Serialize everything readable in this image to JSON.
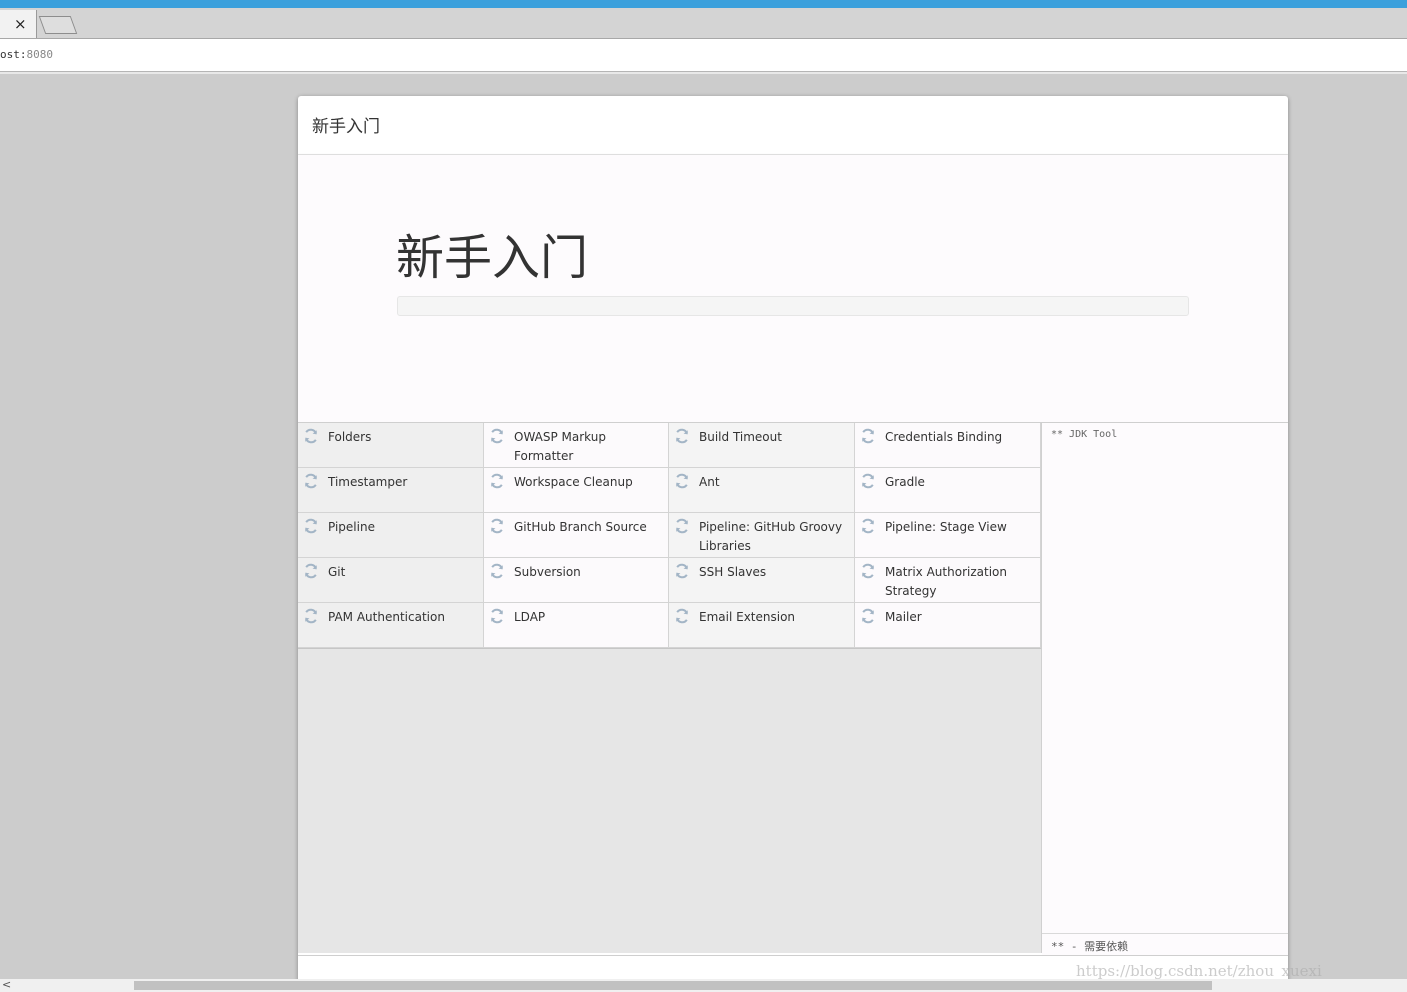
{
  "browser": {
    "tab_close": "×",
    "url_prefix": "ost:",
    "url_port": "8080"
  },
  "dialog": {
    "title": "新手入门",
    "hero_title": "新手入门",
    "progress": 0
  },
  "plugins": [
    {
      "name": "Folders"
    },
    {
      "name": "OWASP Markup Formatter"
    },
    {
      "name": "Build Timeout"
    },
    {
      "name": "Credentials Binding"
    },
    {
      "name": "Timestamper"
    },
    {
      "name": "Workspace Cleanup"
    },
    {
      "name": "Ant"
    },
    {
      "name": "Gradle"
    },
    {
      "name": "Pipeline"
    },
    {
      "name": "GitHub Branch Source"
    },
    {
      "name": "Pipeline: GitHub Groovy Libraries"
    },
    {
      "name": "Pipeline: Stage View"
    },
    {
      "name": "Git"
    },
    {
      "name": "Subversion"
    },
    {
      "name": "SSH Slaves"
    },
    {
      "name": "Matrix Authorization Strategy"
    },
    {
      "name": "PAM Authentication"
    },
    {
      "name": "LDAP"
    },
    {
      "name": "Email Extension"
    },
    {
      "name": "Mailer"
    }
  ],
  "log": {
    "text": "** JDK Tool",
    "footer": "** - 需要依赖"
  },
  "watermark": "https://blog.csdn.net/zhou_xuexi",
  "icons": {
    "plugin_status": "refresh-icon",
    "new_tab": "new-tab-icon"
  },
  "colors": {
    "accent": "#3ba0dc",
    "icon": "#a3b5c6"
  }
}
